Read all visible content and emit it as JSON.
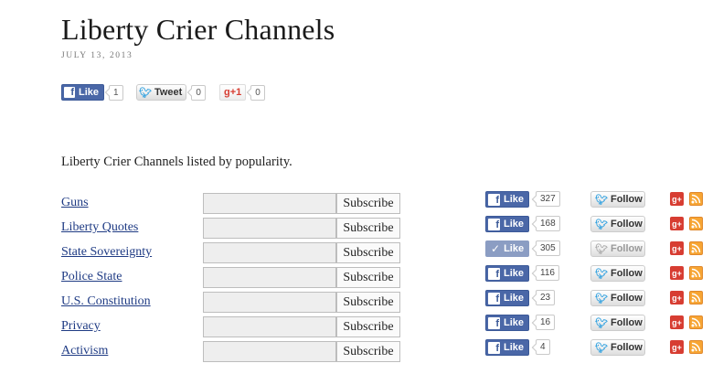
{
  "post": {
    "title": "Liberty Crier Channels",
    "date": "July 13, 2013",
    "intro": "Liberty Crier Channels listed by popularity."
  },
  "share_bar": {
    "facebook": {
      "label": "Like",
      "count": "1"
    },
    "twitter": {
      "label": "Tweet",
      "count": "0"
    },
    "google": {
      "label": "+1",
      "count": "0"
    }
  },
  "subscribe_label": "Subscribe",
  "follow_label": "Follow",
  "like_label": "Like",
  "channels": [
    {
      "name": "Guns",
      "likes": "327",
      "liked": false
    },
    {
      "name": "Liberty Quotes",
      "likes": "168",
      "liked": false
    },
    {
      "name": "State Sovereignty",
      "likes": "305",
      "liked": true
    },
    {
      "name": "Police State",
      "likes": "116",
      "liked": false
    },
    {
      "name": "U.S. Constitution",
      "likes": "23",
      "liked": false
    },
    {
      "name": "Privacy",
      "likes": "16",
      "liked": false
    },
    {
      "name": "Activism",
      "likes": "4",
      "liked": false
    }
  ],
  "icons": {
    "facebook": "facebook-icon",
    "twitter": "twitter-bird-icon",
    "google_plus": "google-plus-icon",
    "rss": "rss-icon",
    "check": "check-icon"
  },
  "colors": {
    "facebook_blue": "#4a67a7",
    "facebook_liked": "#8b9dc3",
    "twitter_blue": "#2ea0e0",
    "google_red": "#d73d32",
    "rss_orange": "#f7a533",
    "link_blue": "#1f3b84"
  }
}
